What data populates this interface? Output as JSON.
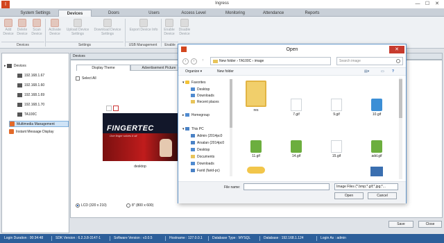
{
  "app": {
    "title": "Ingress",
    "logo_letter": "I"
  },
  "window": {
    "minimize": "—",
    "maximize": "☐",
    "close": "✕"
  },
  "ribbon_tabs": [
    "System Settings",
    "Devices",
    "Doors",
    "Users",
    "Access Level",
    "Monitoring",
    "Attendance",
    "Reports"
  ],
  "ribbon": {
    "buttons": [
      {
        "label": "Add Device",
        "icon": "add-device-icon"
      },
      {
        "label": "Delete Device",
        "icon": "delete-device-icon"
      },
      {
        "label": "Scan Device",
        "icon": "scan-device-icon"
      },
      {
        "label": "Activate Device",
        "icon": "activate-device-icon"
      },
      {
        "label": "Upload Device Settings",
        "icon": "upload-icon"
      },
      {
        "label": "Download Device Settings",
        "icon": "download-icon"
      },
      {
        "label": "Export Device Info",
        "icon": "export-icon"
      },
      {
        "label": "Enable Device",
        "icon": "enable-device-icon"
      },
      {
        "label": "Disable Device",
        "icon": "disable-device-icon"
      }
    ],
    "groups": [
      "Devices",
      "Settings",
      "USB Management",
      "Enable"
    ]
  },
  "tree": {
    "root": "Devices",
    "devices": [
      "192.168.1.67",
      "192.168.1.60",
      "192.168.1.69",
      "192.168.1.70",
      "TA100C"
    ],
    "extras": [
      "Multimedia Management",
      "Instant Message Display"
    ]
  },
  "main": {
    "header": "Devices",
    "tabs": [
      "Display Theme",
      "Advertisement Picture"
    ],
    "select_all": "Select All",
    "image": {
      "logo": "FINGERTEC",
      "slogan": "One finger solves it all",
      "caption": "desktop"
    },
    "resolutions": [
      "LCD (320 x 210)",
      "8\" (800 x 600)"
    ],
    "save": "Save",
    "close": "Close"
  },
  "status": {
    "items": [
      "Login Duration : 00:34:48",
      "SDK Version : 6.2.3.8-3147-1",
      "Software Version : v3.0.5",
      "Hostname : 127.0.0.1",
      "Database Type : MYSQL",
      "Database : 192.168.1.124",
      "Login As : admin"
    ]
  },
  "dialog": {
    "title": "Open",
    "close": "✕",
    "path": [
      "New folder",
      "TA100C",
      "image"
    ],
    "search_placeholder": "Search image",
    "toolbar": {
      "organize": "Organize ▾",
      "new_folder": "New folder"
    },
    "nav": {
      "favorites": "Favorites",
      "favorite_items": [
        "Desktop",
        "Downloads",
        "Recent places"
      ],
      "homegroup": "Homegroup",
      "this_pc": "This PC",
      "pc_items": [
        "Admin (2014pc0",
        "Arsalan (2014pc0",
        "Desktop",
        "Documents",
        "Downloads",
        "Farid (farid-pc)"
      ]
    },
    "files": [
      {
        "name": "res",
        "type": "folder"
      },
      {
        "name": "7.gif",
        "type": "doc"
      },
      {
        "name": "9.gif",
        "type": "doc"
      },
      {
        "name": "10.gif",
        "type": "wifi"
      },
      {
        "name": "11.gif",
        "type": "icon"
      },
      {
        "name": "14.gif",
        "type": "icon"
      },
      {
        "name": "15.gif",
        "type": "doc"
      },
      {
        "name": "add.gif",
        "type": "icon"
      }
    ],
    "file_name_label": "File name:",
    "file_name_value": "",
    "file_type": "Image Files (*.bmp;*.gif;*.jpg;*...",
    "open": "Open",
    "cancel": "Cancel"
  }
}
